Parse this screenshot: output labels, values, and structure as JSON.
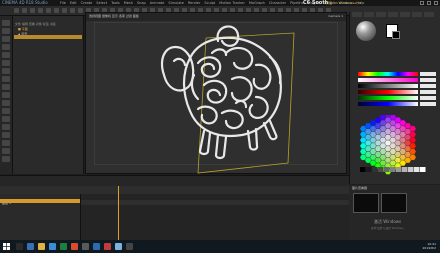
{
  "app": {
    "title": "CINEMA 4D R18 Studio",
    "menus": [
      "File",
      "Edit",
      "Create",
      "Select",
      "Tools",
      "Mesh",
      "Snap",
      "Animate",
      "Simulate",
      "Render",
      "Sculpt",
      "Motion Tracker",
      "MoGraph",
      "Character",
      "Pipeline",
      "Plugins",
      "Script",
      "Window",
      "Help"
    ],
    "brand": "C6 Sooth",
    "workspace": "界面: RS Studio (User) ▾"
  },
  "outliner": {
    "rows": [
      "文件 编辑 查看 对象 标签 书签",
      "■ 平面",
      "▲ 背景"
    ]
  },
  "viewport": {
    "label": "透视视图  摄像机  显示  选项  过滤  面板",
    "camera": "Camera 1"
  },
  "material": {
    "fg_color": "#ffffff",
    "bg_color": "#000000"
  },
  "color_sliders": [
    {
      "name": "H",
      "gradient": "red-spectrum"
    },
    {
      "name": "S",
      "gradient": "white-to-color"
    },
    {
      "name": "V",
      "gradient": "black-to-white"
    },
    {
      "name": "R",
      "gradient": "red"
    },
    {
      "name": "G",
      "gradient": "green"
    },
    {
      "name": "B",
      "gradient": "blue"
    }
  ],
  "timeline": {
    "layer_name": "图层 1",
    "frame": "0"
  },
  "preview": {
    "title": "图片查看器"
  },
  "windows_watermark": {
    "line1": "激活 Windows",
    "line2": "转到\"设置\"以激活 Windows。"
  },
  "taskbar": {
    "time": "10:41",
    "date": "2019/8/2"
  }
}
